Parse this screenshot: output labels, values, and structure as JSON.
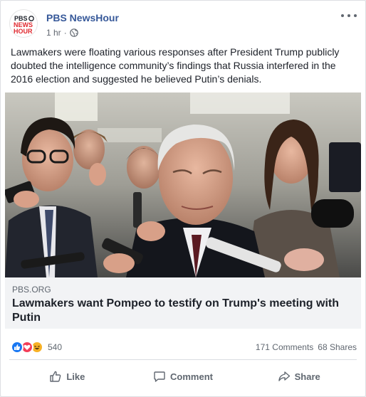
{
  "post": {
    "page_name": "PBS NewsHour",
    "timestamp": "1 hr",
    "privacy_icon": "globe-icon",
    "text": "Lawmakers were floating various responses after President Trump publicly doubted the intelligence community’s findings that Russia interfered in the 2016 election and suggested he believed Putin’s denials."
  },
  "avatar": {
    "lines": [
      "PBS",
      "NEWS",
      "HOUR"
    ]
  },
  "link": {
    "domain": "PBS.ORG",
    "title": "Lawmakers want Pompeo to testify on Trump's meeting with Putin"
  },
  "stats": {
    "reaction_count": "540",
    "comments": "171 Comments",
    "shares": "68 Shares"
  },
  "actions": {
    "like": "Like",
    "comment": "Comment",
    "share": "Share"
  },
  "colors": {
    "link_blue": "#365899",
    "like_blue": "#1877f2",
    "love_red": "#f33e58",
    "haha_yellow": "#f7b125"
  }
}
